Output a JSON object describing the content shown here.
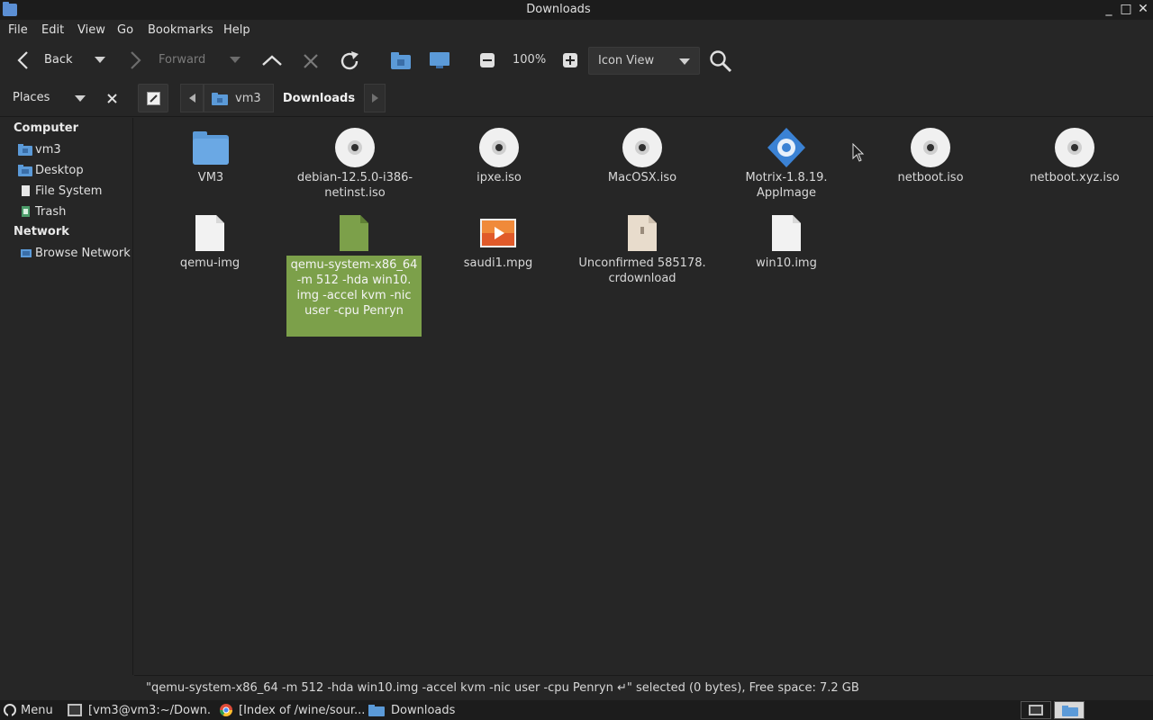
{
  "window": {
    "title": "Downloads",
    "minimize_glyph": "_",
    "maximize_glyph": "□",
    "close_glyph": "✕"
  },
  "menubar": {
    "items": [
      "File",
      "Edit",
      "View",
      "Go",
      "Bookmarks",
      "Help"
    ]
  },
  "toolbar": {
    "back_label": "Back",
    "forward_label": "Forward",
    "zoom_level": "100%",
    "view_mode": "Icon View"
  },
  "locationbar": {
    "places_label": "Places",
    "crumbs": [
      "vm3",
      "Downloads"
    ]
  },
  "sidebar": {
    "computer_header": "Computer",
    "computer_items": [
      "vm3",
      "Desktop",
      "File System",
      "Trash"
    ],
    "network_header": "Network",
    "network_items": [
      "Browse Network"
    ]
  },
  "files": [
    {
      "name": "VM3",
      "icon": "folder-icon"
    },
    {
      "name": "debian-12.5.0-i386-\nnetinst.iso",
      "icon": "disc-icon"
    },
    {
      "name": "ipxe.iso",
      "icon": "disc-icon"
    },
    {
      "name": "MacOSX.iso",
      "icon": "disc-icon"
    },
    {
      "name": "Motrix-1.8.19.\nAppImage",
      "icon": "gear-package-icon"
    },
    {
      "name": "netboot.iso",
      "icon": "disc-icon"
    },
    {
      "name": "netboot.xyz.iso",
      "icon": "disc-icon"
    },
    {
      "name": "qemu-img",
      "icon": "document-icon"
    },
    {
      "name": "qemu-system-x86_64\n-m 512 -hda win10.\nimg -accel kvm -nic\nuser -cpu Penryn",
      "icon": "script-icon",
      "selected": true
    },
    {
      "name": "saudi1.mpg",
      "icon": "video-icon"
    },
    {
      "name": "Unconfirmed 585178.\ncrdownload",
      "icon": "archive-icon"
    },
    {
      "name": "win10.img",
      "icon": "document-icon"
    }
  ],
  "statusbar": {
    "text": "\"qemu-system-x86_64 -m 512 -hda win10.img -accel kvm -nic user -cpu Penryn ↵\" selected (0 bytes), Free space: 7.2 GB"
  },
  "taskbar": {
    "menu_label": "Menu",
    "tasks": [
      "[vm3@vm3:~/Down...",
      "[Index of /wine/sour...",
      "Downloads"
    ]
  },
  "colors": {
    "background": "#262626",
    "selection": "#7ca04a",
    "folder_blue": "#5b9ad8"
  }
}
